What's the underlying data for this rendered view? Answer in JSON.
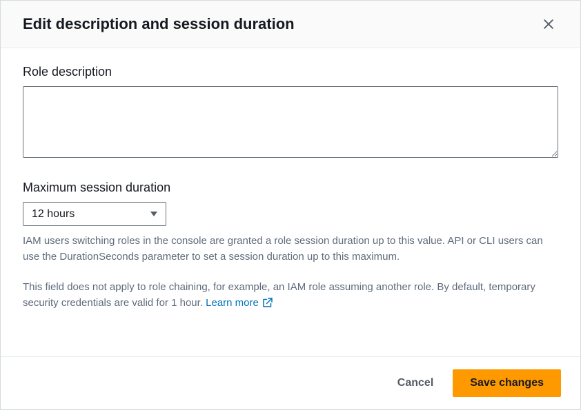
{
  "modal": {
    "title": "Edit description and session duration"
  },
  "form": {
    "role_description": {
      "label": "Role description",
      "value": ""
    },
    "max_session_duration": {
      "label": "Maximum session duration",
      "selected": "12 hours",
      "helper1": "IAM users switching roles in the console are granted a role session duration up to this value. API or CLI users can use the DurationSeconds parameter to set a session duration up to this maximum.",
      "helper2": "This field does not apply to role chaining, for example, an IAM role assuming another role. By default, temporary security credentials are valid for 1 hour. ",
      "learn_more": "Learn more"
    }
  },
  "footer": {
    "cancel": "Cancel",
    "save": "Save changes"
  }
}
